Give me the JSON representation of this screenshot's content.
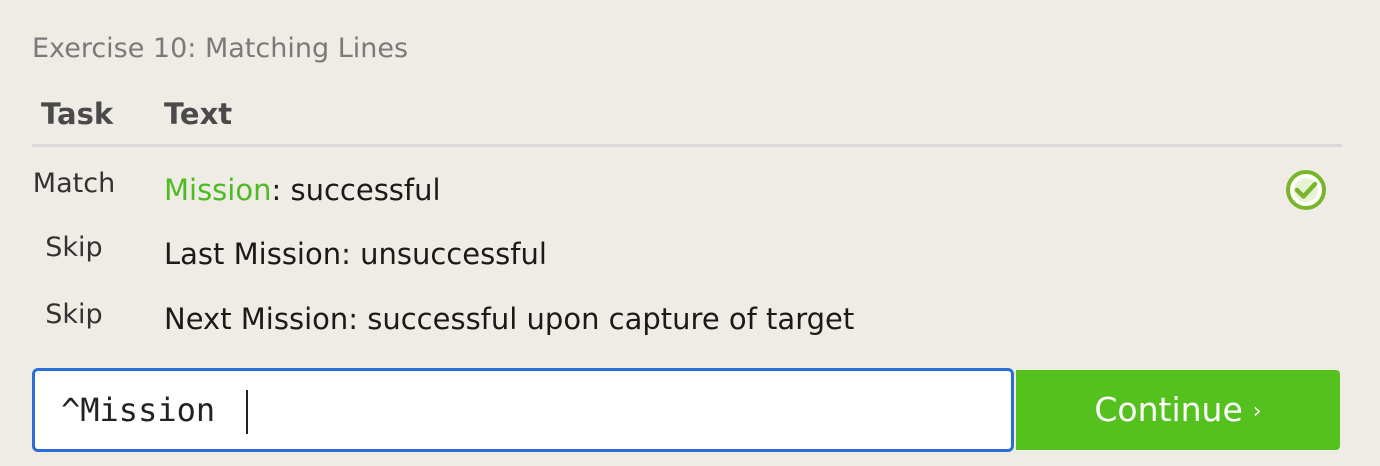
{
  "exercise": {
    "title": "Exercise 10: Matching Lines"
  },
  "table": {
    "headers": {
      "task": "Task",
      "text": "Text"
    },
    "rows": [
      {
        "task": "Match",
        "text_highlight": "Mission",
        "text_rest": ": successful",
        "status_icon": "check-circle-icon",
        "status": "matched"
      },
      {
        "task": "Skip",
        "text": "Last Mission: unsuccessful"
      },
      {
        "task": "Skip",
        "text": "Next Mission: successful upon capture of target"
      }
    ]
  },
  "answer": {
    "value": "^Mission"
  },
  "continue_button": {
    "label": "Continue",
    "icon": "›"
  },
  "colors": {
    "background": "#efece6",
    "match_highlight": "#4dbb22",
    "button": "#55c11f",
    "input_border": "#2a6fd6",
    "check": "#79b52a"
  }
}
